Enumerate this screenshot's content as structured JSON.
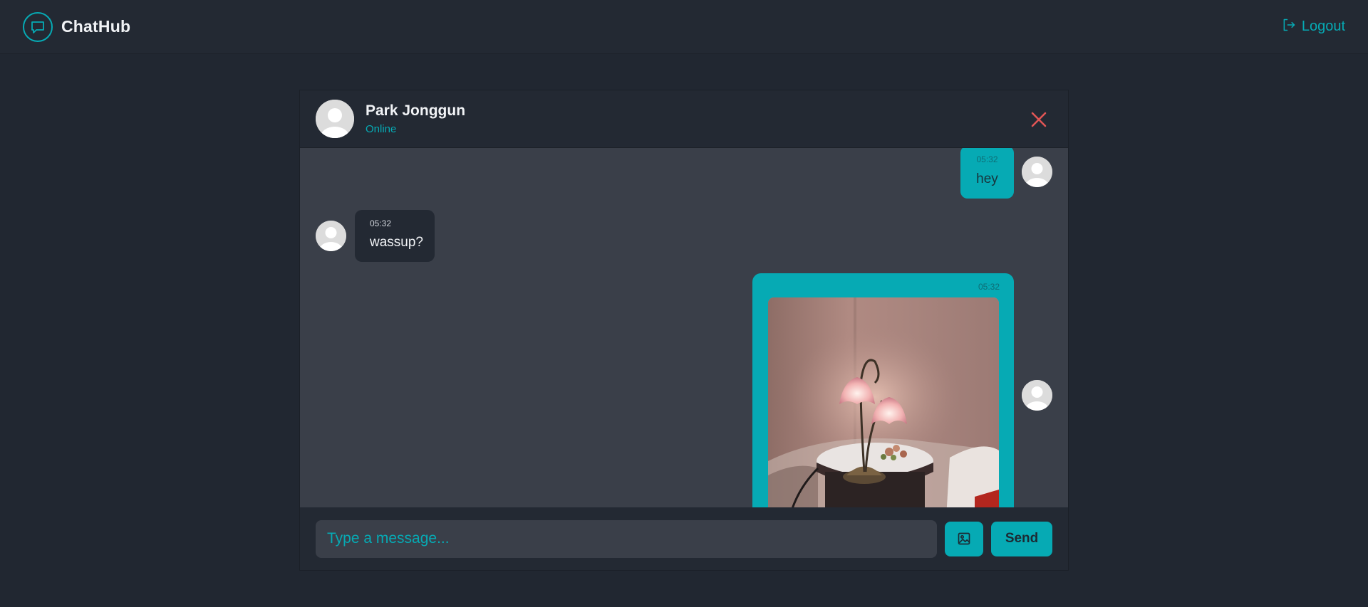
{
  "app": {
    "name": "ChatHub",
    "logout_label": "Logout"
  },
  "chat": {
    "contact_name": "Park Jonggun",
    "contact_status": "Online",
    "messages": [
      {
        "from": "me",
        "time": "05:32",
        "text": "hey"
      },
      {
        "from": "them",
        "time": "05:32",
        "text": "wassup?"
      },
      {
        "from": "me",
        "time": "05:32",
        "type": "image"
      }
    ]
  },
  "composer": {
    "placeholder": "Type a message...",
    "send_label": "Send"
  },
  "icons": {
    "brand": "chat-bubble-icon",
    "logout": "logout-icon",
    "close": "close-icon",
    "attach": "image-icon",
    "avatar": "user-avatar-icon"
  },
  "colors": {
    "accent": "#06aab4",
    "background": "#212731",
    "panel": "#232933",
    "messages_bg": "#3a3f49",
    "close": "#e05555"
  }
}
